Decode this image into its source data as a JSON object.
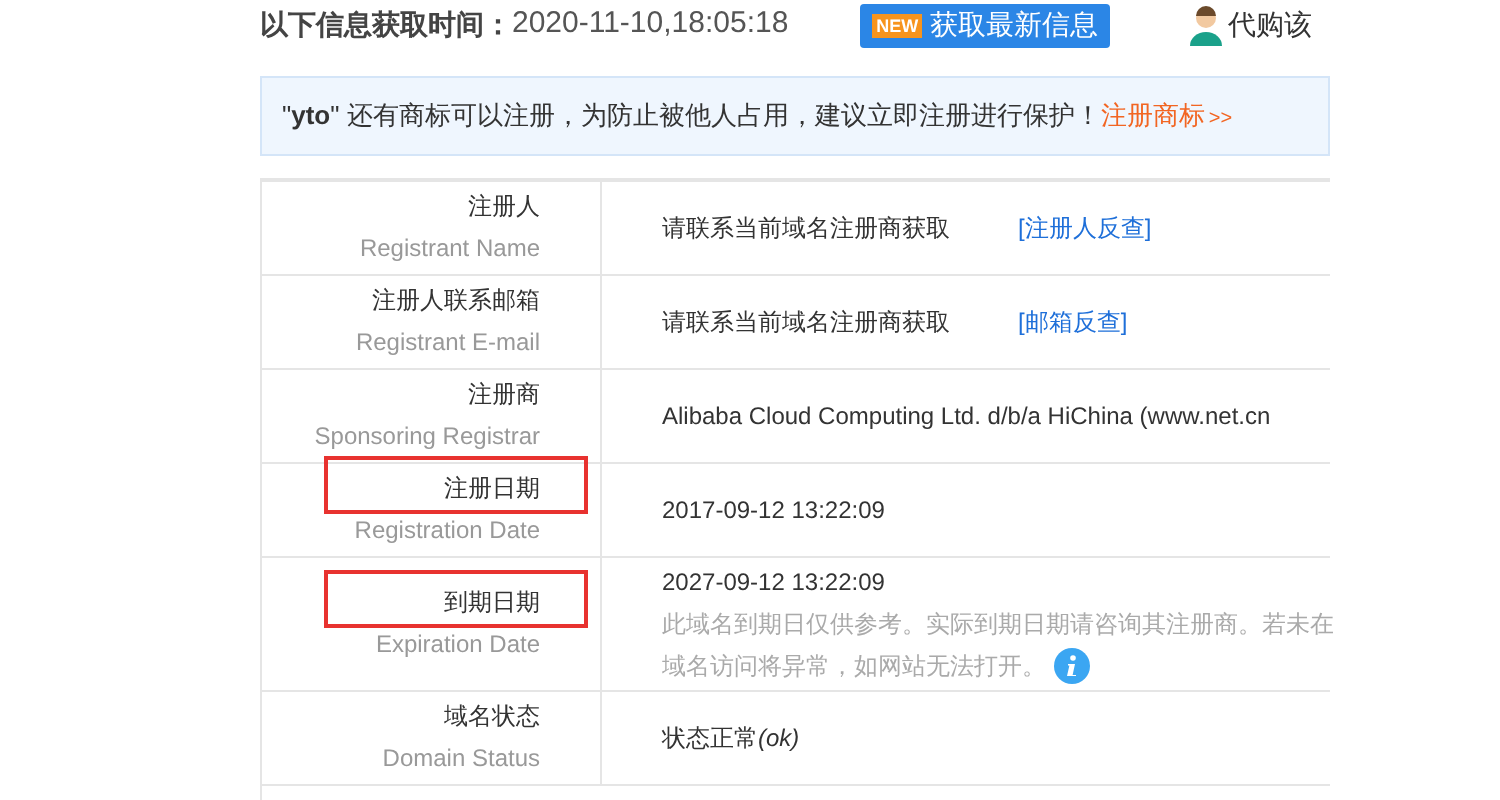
{
  "header": {
    "label": "以下信息获取时间：",
    "time": "2020-11-10,18:05:18",
    "refresh_button": {
      "badge": "NEW",
      "label": "获取最新信息"
    },
    "buy_link": "代购该"
  },
  "notice": {
    "text": "\"**yto**\" 还有商标可以注册，为防止被他人占用，建议立即注册进行保护！",
    "link": "注册商标",
    "link_arrows": ">>"
  },
  "rows": [
    {
      "kind": "link",
      "label": "注册人",
      "label_en": "Registrant Name",
      "value": "请联系当前域名注册商获取",
      "link": "[注册人反查]",
      "highlighted": false
    },
    {
      "kind": "link",
      "label": "注册人联系邮箱",
      "label_en": "Registrant E-mail",
      "value": "请联系当前域名注册商获取",
      "link": "[邮箱反查]",
      "highlighted": false
    },
    {
      "kind": "plain",
      "label": "注册商",
      "label_en": "Sponsoring Registrar",
      "value": "Alibaba Cloud Computing Ltd. d/b/a HiChina (www.net.cn",
      "highlighted": false
    },
    {
      "kind": "plain",
      "label": "注册日期",
      "label_en": "Registration Date",
      "value": "2017-09-12 13:22:09",
      "highlighted": true
    },
    {
      "kind": "note",
      "label": "到期日期",
      "label_en": "Expiration Date",
      "value": "2027-09-12 13:22:09",
      "note_lines": [
        "此域名到期日仅供参考。实际到期日期请咨询其注册商。若未在",
        "域名访问将异常，如网站无法打开。"
      ],
      "highlighted": true
    },
    {
      "kind": "rich",
      "label": "域名状态",
      "label_en": "Domain Status",
      "value": "状态正常",
      "value_code": "(ok)",
      "highlighted": false
    }
  ]
}
